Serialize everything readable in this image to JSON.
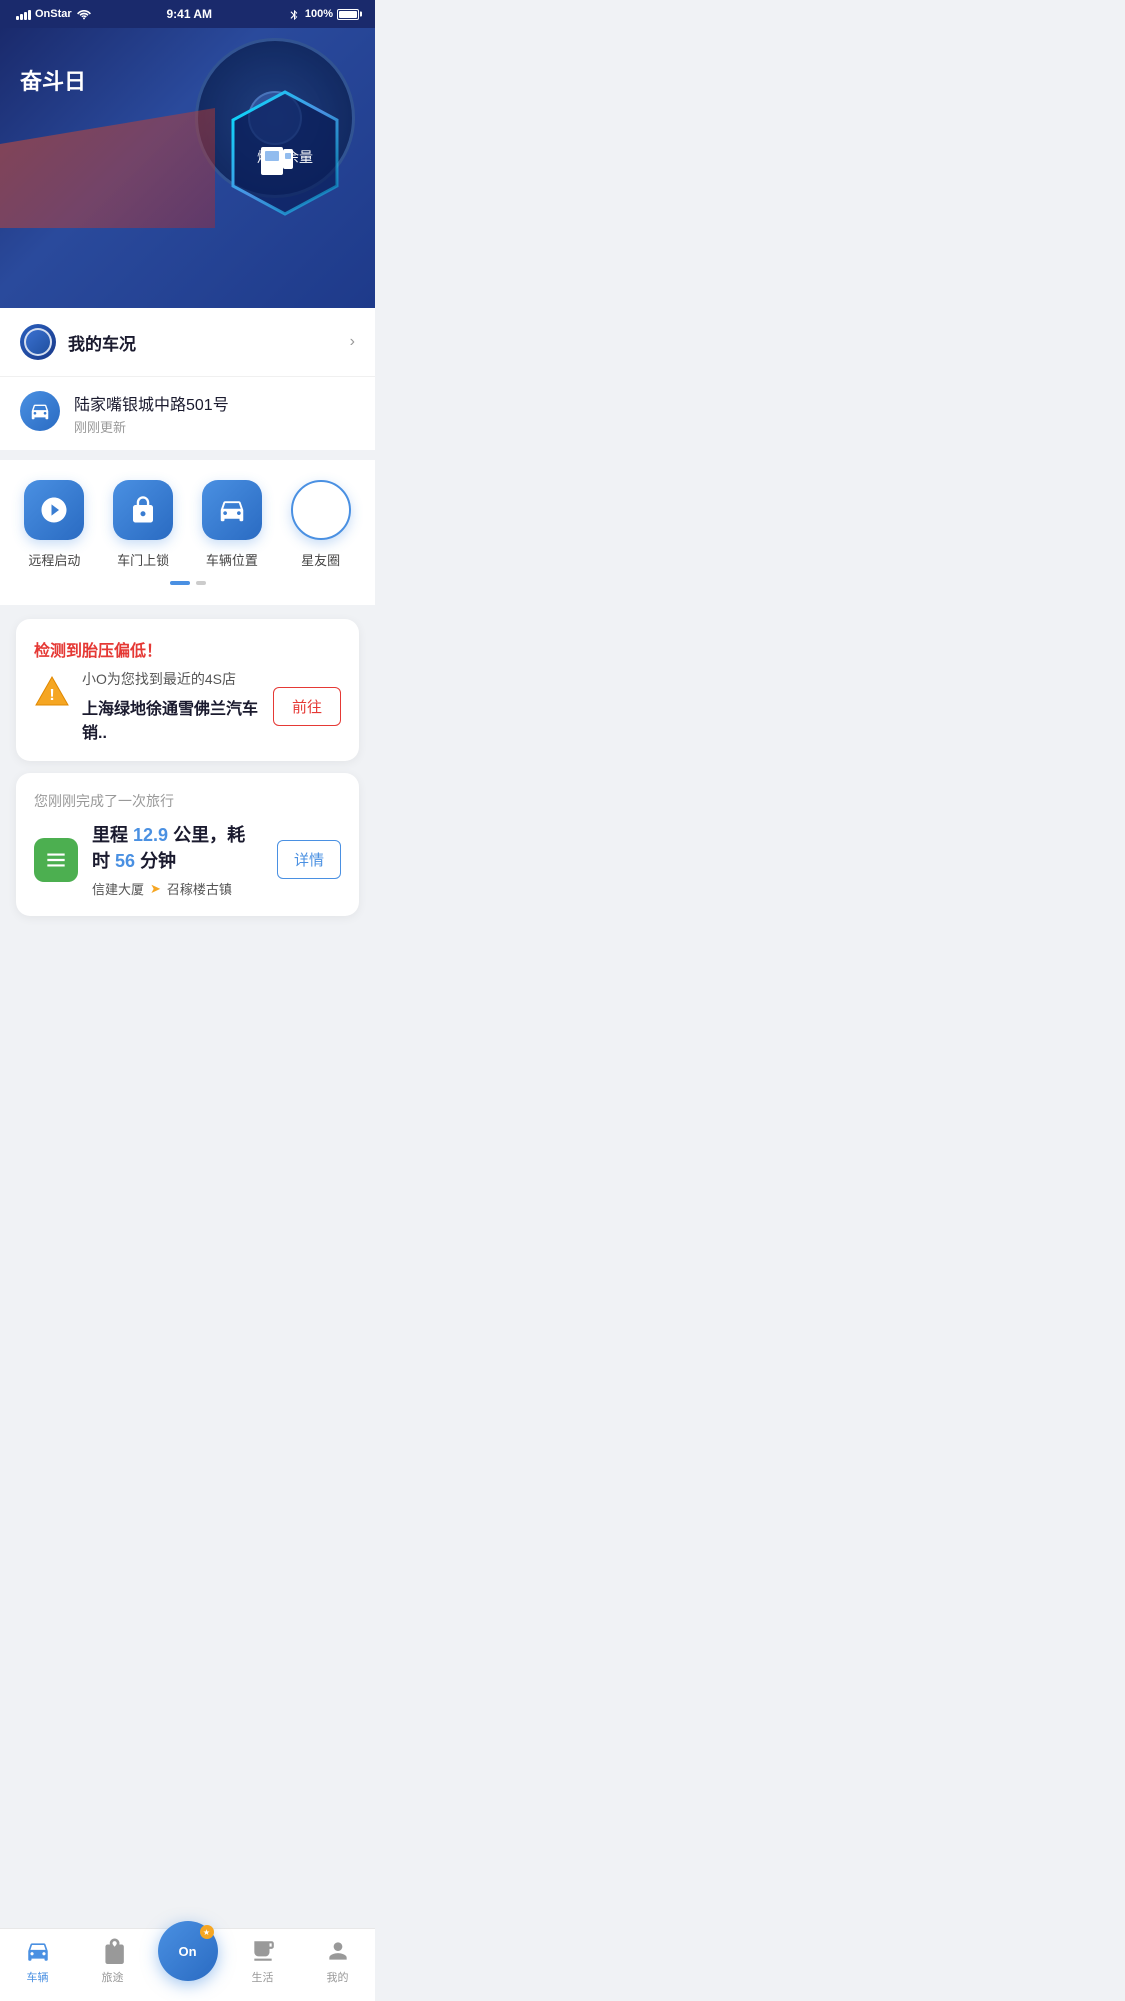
{
  "statusBar": {
    "carrier": "OnStar",
    "time": "9:41 AM",
    "battery": "100%"
  },
  "hero": {
    "pageTitle": "奋斗日",
    "fuelLabel": "燃油余量"
  },
  "vehicleStatus": {
    "title": "我的车况",
    "chevron": "›"
  },
  "location": {
    "address": "陆家嘴银城中路501号",
    "updateTime": "刚刚更新"
  },
  "quickActions": [
    {
      "id": "remote-start",
      "label": "远程启动"
    },
    {
      "id": "door-lock",
      "label": "车门上锁"
    },
    {
      "id": "vehicle-location",
      "label": "车辆位置"
    },
    {
      "id": "star-circle",
      "label": "星友圈"
    }
  ],
  "alertCard": {
    "title": "检测到胎压偏低！",
    "subText": "小O为您找到最近的4S店",
    "shopName": "上海绿地徐通雪佛兰汽车销..",
    "goButton": "前往"
  },
  "tripCard": {
    "header": "您刚刚完成了一次旅行",
    "statsPrefix": "里程",
    "distance": "12.9",
    "distanceUnit": "公里，耗时",
    "duration": "56",
    "durationUnit": "分钟",
    "from": "信建大厦",
    "to": "召稼楼古镇",
    "detailButton": "详情"
  },
  "bottomNav": {
    "items": [
      {
        "id": "vehicle",
        "label": "车辆",
        "active": true
      },
      {
        "id": "trip",
        "label": "旅途",
        "active": false
      },
      {
        "id": "center",
        "label": "On",
        "active": false
      },
      {
        "id": "life",
        "label": "生活",
        "active": false
      },
      {
        "id": "mine",
        "label": "我的",
        "active": false
      }
    ]
  }
}
